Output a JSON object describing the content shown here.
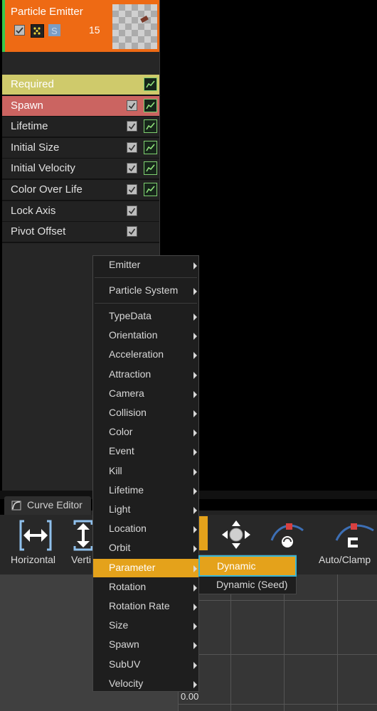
{
  "emitter": {
    "name": "Particle Emitter",
    "count": "15",
    "accent_color": "#ee6a14",
    "enabled_color": "#37c94a"
  },
  "modules": [
    {
      "label": "Required",
      "checkbox": false,
      "curve": true
    },
    {
      "label": "Spawn",
      "checkbox": true,
      "curve": true
    },
    {
      "label": "Lifetime",
      "checkbox": true,
      "curve": true
    },
    {
      "label": "Initial Size",
      "checkbox": true,
      "curve": true
    },
    {
      "label": "Initial Velocity",
      "checkbox": true,
      "curve": true
    },
    {
      "label": "Color Over Life",
      "checkbox": true,
      "curve": true
    },
    {
      "label": "Lock Axis",
      "checkbox": true,
      "curve": false
    },
    {
      "label": "Pivot Offset",
      "checkbox": true,
      "curve": false
    }
  ],
  "curve_editor": {
    "tab_label": "Curve Editor",
    "toolbar": {
      "horizontal": "Horizontal",
      "vertical": "Verti",
      "auto_clamp": "Auto/Clamp"
    },
    "axis_zero": "0.00"
  },
  "context_menu": {
    "items": [
      "Emitter",
      "Particle System",
      "TypeData",
      "Orientation",
      "Acceleration",
      "Attraction",
      "Camera",
      "Collision",
      "Color",
      "Event",
      "Kill",
      "Lifetime",
      "Light",
      "Location",
      "Orbit",
      "Parameter",
      "Rotation",
      "Rotation Rate",
      "Size",
      "Spawn",
      "SubUV",
      "Velocity"
    ],
    "active_item": "Parameter",
    "highlight_color": "#e4a21b"
  },
  "sub_menu": {
    "items": [
      "Dynamic",
      "Dynamic (Seed)"
    ],
    "active_item": "Dynamic",
    "focus_color": "#38b6d8"
  }
}
